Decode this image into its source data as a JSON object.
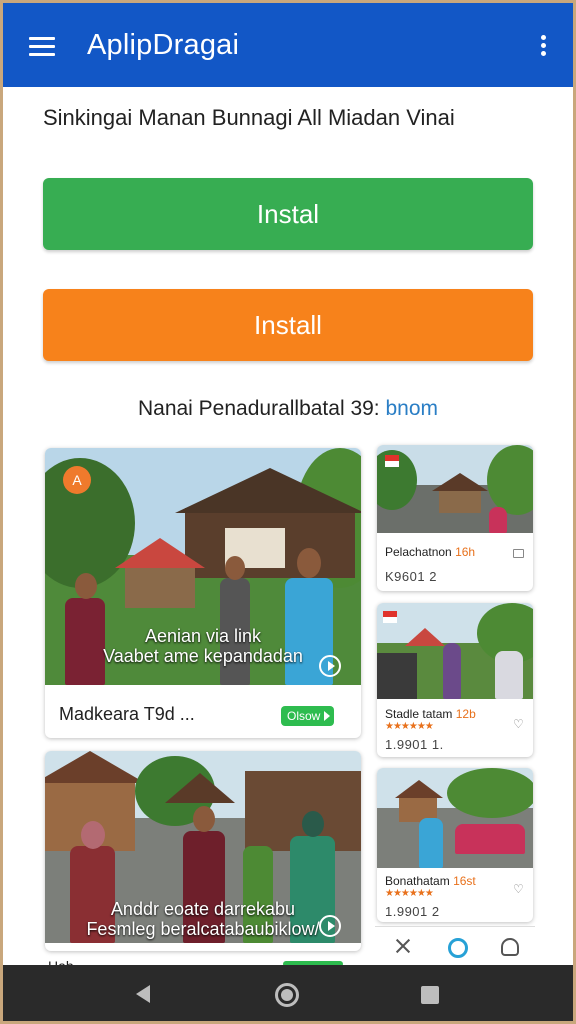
{
  "app": {
    "title": "AplipDragai"
  },
  "header": {
    "subtitle": "Sinkingai Manan Bunnagi All Miadan Vinai"
  },
  "buttons": {
    "primary_label": "Instal",
    "secondary_label": "Install"
  },
  "info": {
    "text": "Nanai Penadurallbatal 39:",
    "accent": "bnom"
  },
  "featured": [
    {
      "overlay_line1": "Aenian via link",
      "overlay_line2": "Vaabet ame kepandadan",
      "caption": "Madkeara T9d ...",
      "pill": "Olsow",
      "badge": "A"
    },
    {
      "overlay_line1": "Anddr eoate darrekabu",
      "overlay_line2": "Fesmleg beralcatabaubiklow/",
      "caption": "Hab...",
      "pill": ""
    }
  ],
  "side_cards": [
    {
      "title": "Pelachatnon",
      "title_highlight": "16h",
      "meta": "K9601 2",
      "stars": ""
    },
    {
      "title": "Stadle tatam",
      "title_highlight": "12b",
      "meta": "1.9901 1.",
      "stars": "★★★★★★"
    },
    {
      "title": "Bonathatam",
      "title_highlight": "16st",
      "meta": "1.9901 2",
      "stars": "★★★★★★"
    }
  ],
  "icons": {
    "menu": "menu-icon",
    "more": "more-vert-icon",
    "play": "play-icon",
    "tools": "tools-icon",
    "search": "search-icon",
    "profile": "profile-icon",
    "back": "back-icon",
    "home": "home-icon",
    "recents": "recents-icon"
  },
  "colors": {
    "appbar": "#1257c6",
    "green": "#37ad52",
    "orange": "#f7821b",
    "accent_blue": "#2a7ec5",
    "pill_green": "#2ebc4f",
    "navbar": "#2a2a2a"
  }
}
